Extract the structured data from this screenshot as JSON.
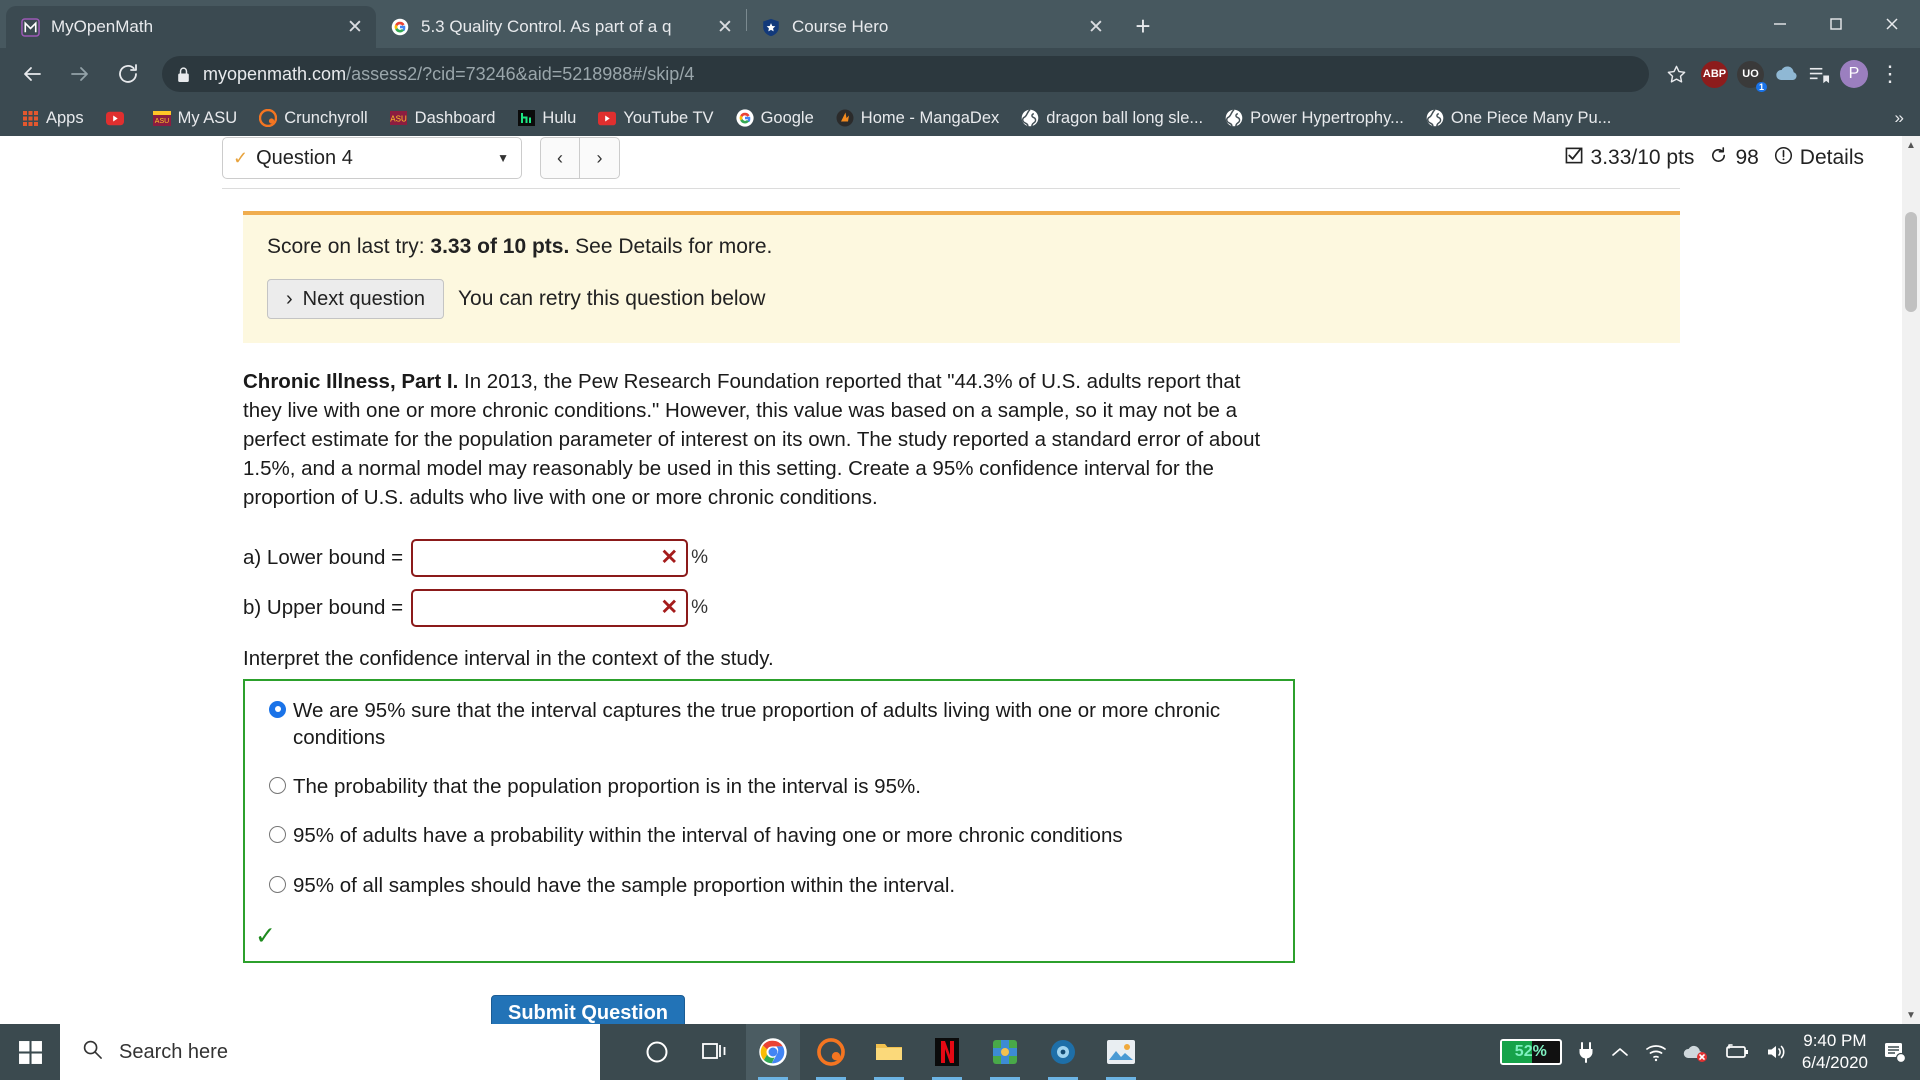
{
  "browser": {
    "tabs": [
      {
        "title": "MyOpenMath",
        "favicon": "myopenmath-logo-icon",
        "active": true,
        "close_label": "✕"
      },
      {
        "title": "5.3 Quality Control. As part of a q",
        "favicon": "google-icon",
        "active": false,
        "close_label": "✕"
      },
      {
        "title": "Course Hero",
        "favicon": "course-hero-shield-icon",
        "active": false,
        "close_label": "✕"
      }
    ],
    "new_tab_label": "+",
    "window_controls": {
      "minimize": "—",
      "maximize": "❐",
      "close": "✕"
    },
    "nav": {
      "back": "←",
      "forward": "→",
      "reload": "⟳"
    },
    "omnibox": {
      "lock_icon": "lock-icon",
      "url_domain": "myopenmath.com",
      "url_path": "/assess2/?cid=73246&aid=5218988#/skip/4",
      "star_icon": "star-icon"
    },
    "profile_badges": [
      {
        "name": "abp-extension-icon",
        "label": "ABP",
        "color": "#8d1c1c"
      },
      {
        "name": "uo-extension-icon",
        "label": "UO",
        "color": "#3a3a3a",
        "count": "1"
      },
      {
        "name": "cloud-extension-icon",
        "label": "",
        "color": "#7aa8c8"
      }
    ],
    "toolbar_icons": [
      {
        "name": "reading-list-icon",
        "glyph": "☰"
      },
      {
        "name": "profile-avatar-icon",
        "glyph": "P"
      },
      {
        "name": "chrome-menu-icon",
        "glyph": "⋮"
      }
    ],
    "bookmarks": [
      {
        "label": "Apps",
        "icon": "apps-grid-icon"
      },
      {
        "label": "",
        "icon": "youtube-icon"
      },
      {
        "label": "My ASU",
        "icon": "asu-icon"
      },
      {
        "label": "Crunchyroll",
        "icon": "crunchyroll-icon"
      },
      {
        "label": "Dashboard",
        "icon": "dashboard-icon"
      },
      {
        "label": "Hulu",
        "icon": "hulu-icon"
      },
      {
        "label": "YouTube TV",
        "icon": "youtube-tv-icon"
      },
      {
        "label": "Google",
        "icon": "google-icon"
      },
      {
        "label": "Home - MangaDex",
        "icon": "mangadex-icon"
      },
      {
        "label": "dragon ball long sle...",
        "icon": "globe-icon"
      },
      {
        "label": "Power Hypertrophy...",
        "icon": "globe-icon"
      },
      {
        "label": "One Piece Many Pu...",
        "icon": "globe-icon"
      }
    ],
    "bookmarks_overflow": "»"
  },
  "question_header": {
    "selected_question": "Question 4",
    "status_icon": "checkmark-icon",
    "caret_icon": "chevron-down-icon",
    "prev_label": "‹",
    "next_label": "›",
    "score_icon": "checkbox-icon",
    "score_text": "3.33/10 pts",
    "attempts_icon": "retry-icon",
    "attempts_text": "98",
    "details_icon": "info-icon",
    "details_text": "Details"
  },
  "alert": {
    "score_prefix": "Score on last try: ",
    "score_bold": "3.33 of 10 pts.",
    "score_suffix": " See Details for more.",
    "next_question_label": "Next question",
    "next_question_icon": "chevron-right-icon",
    "retry_text": "You can retry this question below"
  },
  "question": {
    "title": "Chronic Illness, Part I.",
    "body": " In 2013, the Pew Research Foundation reported that \"44.3% of U.S. adults report that they live with one or more chronic conditions.\" However, this value was based on a sample, so it may not be a perfect estimate for the population parameter of interest on its own. The study reported a standard error of about 1.5%, and a normal model may reasonably be used in this setting. Create a 95% confidence interval for the proportion of U.S. adults who live with one or more chronic conditions.",
    "answers": [
      {
        "label": "a) Lower bound =",
        "value": "",
        "status_icon": "error-x-icon",
        "status_glyph": "✕",
        "unit": "%"
      },
      {
        "label": "b) Upper bound =",
        "value": "",
        "status_icon": "error-x-icon",
        "status_glyph": "✕",
        "unit": "%"
      }
    ],
    "interpret_prompt": "Interpret the confidence interval in the context of the study.",
    "choices": [
      {
        "text": "We are 95% sure that the interval captures the true proportion of adults living with one or more chronic conditions",
        "selected": true
      },
      {
        "text": "The probability that the population proportion is in the interval is 95%.",
        "selected": false
      },
      {
        "text": "95% of adults have a probability within the interval of having one or more chronic conditions",
        "selected": false
      },
      {
        "text": "95% of all samples should have the sample proportion within the interval.",
        "selected": false
      }
    ],
    "choice_correct_icon": "green-check-icon",
    "choice_correct_glyph": "✓",
    "submit_label": "Submit Question"
  },
  "scrollbar": {
    "up": "▲",
    "down": "▼"
  },
  "taskbar": {
    "start_icon": "windows-start-icon",
    "search_icon": "search-icon",
    "search_placeholder": "Search here",
    "items": [
      {
        "name": "cortana-icon"
      },
      {
        "name": "task-view-icon"
      },
      {
        "name": "chrome-icon",
        "running": true,
        "active": true
      },
      {
        "name": "crunchyroll-icon",
        "running": true
      },
      {
        "name": "file-explorer-icon",
        "running": true
      },
      {
        "name": "netflix-icon",
        "running": true
      },
      {
        "name": "minecraft-icon",
        "running": true
      },
      {
        "name": "media-player-icon",
        "running": true
      },
      {
        "name": "photos-icon",
        "running": true
      }
    ],
    "tray": {
      "battery_percent": "52%",
      "battery_level": 52,
      "plug_icon": "power-plug-icon",
      "chevron_icon": "show-hidden-icons-icon",
      "wifi_icon": "wifi-icon",
      "onedrive_icon": "onedrive-error-icon",
      "battery_icon": "battery-icon",
      "volume_icon": "volume-icon",
      "time": "9:40 PM",
      "date": "6/4/2020",
      "action_center_icon": "action-center-icon"
    },
    "colors": {
      "accent": "#3b4a4f",
      "battery_fill": "#16a34a"
    }
  },
  "colors": {
    "chrome_tabstrip": "#47585f",
    "chrome_toolbar": "#3b4a51",
    "alert_bg": "#fdf8df",
    "alert_border": "#f0ad4e",
    "input_error": "#8b1a1a",
    "choice_border": "#2ca02c",
    "submit_bg": "#2273b7",
    "radio_selected": "#1a73e8"
  }
}
